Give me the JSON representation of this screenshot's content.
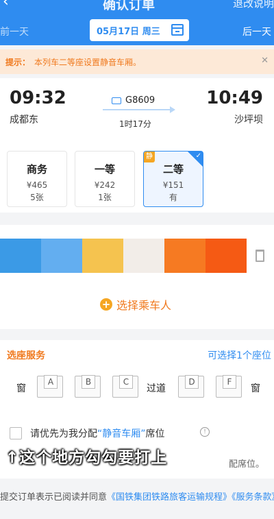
{
  "header": {
    "title": "确认订单",
    "back_glyph": "‹",
    "rules": "退改说明",
    "prev_day": "前一天",
    "next_day": "后一天",
    "date": "05月17日 周三"
  },
  "notice": {
    "label": "提示：",
    "text": "本列车二等座设置静音车厢。",
    "close": "✕"
  },
  "train": {
    "dep_time": "09:32",
    "arr_time": "10:49",
    "dep_station": "成都东",
    "arr_station": "沙坪坝",
    "number": "G8609",
    "duration": "1时17分"
  },
  "seats": [
    {
      "name": "商务",
      "price": "¥465",
      "avail": "5张"
    },
    {
      "name": "一等",
      "price": "¥242",
      "avail": "1张"
    },
    {
      "name": "二等",
      "price": "¥151",
      "avail": "有",
      "badge": "静",
      "selected": true
    }
  ],
  "passenger": {
    "mosaic_colors": [
      "#3b9ae6",
      "#63aef0",
      "#f5c34f",
      "#f2ede8",
      "#f67a22",
      "#f55a14"
    ],
    "add_label": "选择乘车人"
  },
  "seat_service": {
    "title": "选座服务",
    "hint": "可选择1个座位",
    "window_label": "窗",
    "aisle_label": "过道",
    "letters": [
      "A",
      "B",
      "C",
      "D",
      "F"
    ]
  },
  "quiet": {
    "prefix": "请优先为我分配",
    "highlight": "“静音车厢”",
    "suffix": "席位",
    "info": "!"
  },
  "note": {
    "text": "配席位。"
  },
  "caption": "↑这个地方勾勾要打上",
  "agreement": {
    "prefix": "提交订单表示已阅读并同意",
    "link1": "《国铁集团铁路旅客运输规程》",
    "link2": "《服务条款》"
  },
  "colors": {
    "brand_blue": "#2f8cf0",
    "accent_orange": "#f07a1f"
  }
}
